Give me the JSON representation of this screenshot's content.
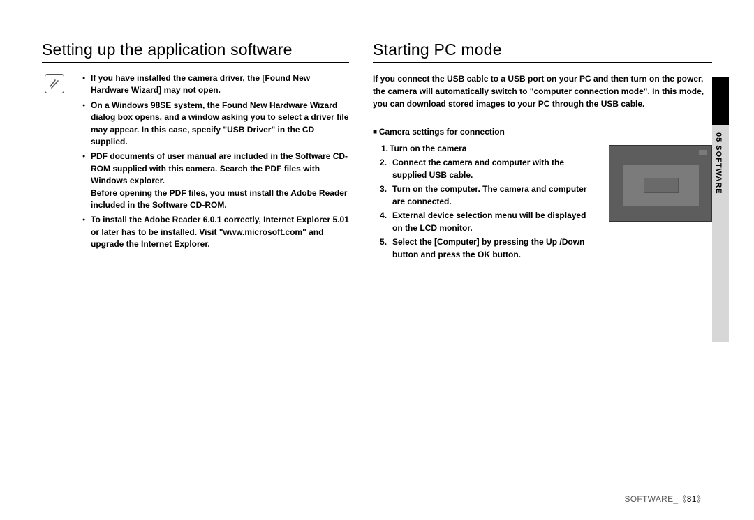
{
  "left": {
    "title": "Setting up the application software",
    "bullets": [
      "If you have installed the camera driver, the [Found New Hardware Wizard] may not open.",
      "On a Windows 98SE system, the Found New Hardware Wizard dialog box opens, and a window asking you to select a driver file may appear. In this case, specify \"USB Driver\" in the CD supplied.",
      "PDF documents of user manual are included in the Software CD-ROM supplied with this camera. Search the PDF files with Windows explorer.",
      "To install the Adobe Reader 6.0.1 correctly, Internet Explorer 5.01 or later has to be installed. Visit \"www.microsoft.com\" and upgrade the Internet Explorer."
    ],
    "bullet3_sub": "Before opening the PDF files, you must install the Adobe Reader included in the Software CD-ROM."
  },
  "right": {
    "title": "Starting PC mode",
    "intro": "If you connect the USB cable to a USB port on your PC and then turn on the power, the camera will automatically switch to \"computer connection mode\". In this mode, you can download stored images to your PC through the USB cable.",
    "subhead": "Camera settings for connection",
    "steps": [
      "Turn on the camera",
      "Connect the camera and computer with the supplied USB cable.",
      "Turn on the computer. The camera and computer are connected.",
      "External device selection menu will be displayed on the LCD monitor.",
      "Select the [Computer] by pressing the Up /Down button and press the OK button."
    ]
  },
  "sidebar": "05 SOFTWARE",
  "footer_label": "SOFTWARE_",
  "page_number": "81",
  "angle_open": "《",
  "angle_close": "》"
}
